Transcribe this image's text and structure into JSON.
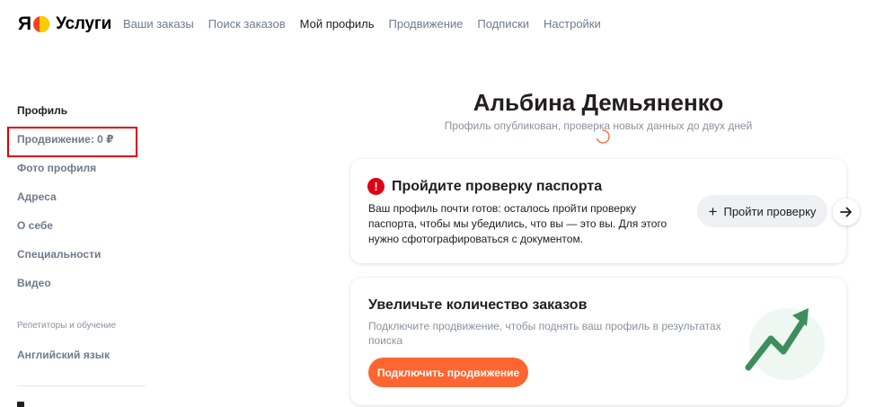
{
  "header": {
    "logo_letter": "Я",
    "logo_text": "Услуги",
    "nav": [
      {
        "label": "Ваши заказы"
      },
      {
        "label": "Поиск заказов"
      },
      {
        "label": "Мой профиль"
      },
      {
        "label": "Продвижение"
      },
      {
        "label": "Подписки"
      },
      {
        "label": "Настройки"
      }
    ]
  },
  "sidebar": {
    "items": [
      {
        "label": "Профиль"
      },
      {
        "label": "Продвижение: 0 ₽"
      },
      {
        "label": "Фото профиля"
      },
      {
        "label": "Адреса"
      },
      {
        "label": "О себе"
      },
      {
        "label": "Специальности"
      },
      {
        "label": "Видео"
      }
    ],
    "group_label": "Репетиторы и обучение",
    "group_items": [
      {
        "label": "Английский язык"
      }
    ]
  },
  "profile": {
    "name": "Альбина Демьяненко",
    "status": "Профиль опубликован, проверка новых данных до двух дней"
  },
  "passport_card": {
    "warning_symbol": "!",
    "title": "Пройдите проверку паспорта",
    "description": "Ваш профиль почти готов: осталось пройти проверку паспорта, чтобы мы убедились, что вы — это вы. Для этого нужно сфотографироваться с документом.",
    "button_plus": "+",
    "button_label": "Пройти проверку"
  },
  "promo_card": {
    "title": "Увеличьте количество заказов",
    "description": "Подключите продвижение, чтобы поднять ваш профиль в результатах поиска",
    "button_label": "Подключить продвижение"
  },
  "colors": {
    "accent_orange": "#fe6531",
    "warning_red": "#e00016",
    "highlight_red": "#e00000",
    "graph_green": "#3e8e5d",
    "text_primary": "#21201f",
    "text_secondary": "#8a929d",
    "nav_gray": "#6f7a8b"
  },
  "icons": {
    "warning": "exclamation-circle-icon",
    "plus": "plus-icon",
    "next": "arrow-right-icon",
    "growth": "growth-chart-icon",
    "loading": "spinner-icon"
  }
}
